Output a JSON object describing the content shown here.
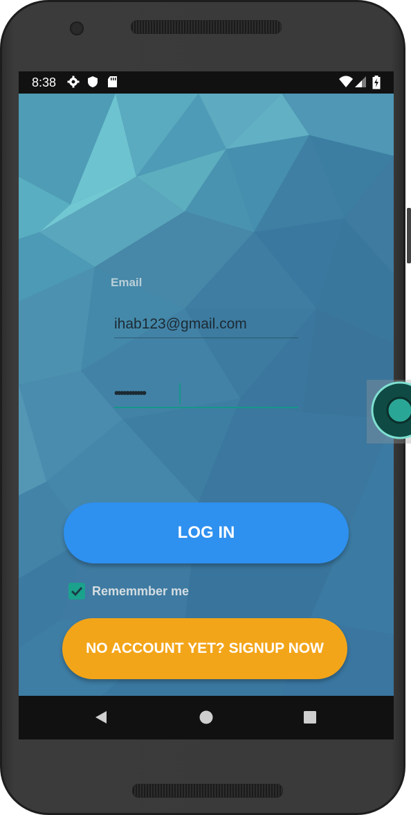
{
  "status_bar": {
    "time": "8:38",
    "icons_left": [
      "gear-icon",
      "shield-icon",
      "sd-card-icon"
    ],
    "icons_right": [
      "wifi-icon",
      "signal-icon",
      "battery-charging-icon"
    ]
  },
  "login_form": {
    "email_label": "Email",
    "email_value": "ihab123@gmail.com",
    "password_masked": "•••••••••••",
    "login_button": "LOG IN",
    "remember_label": "Rememmber me",
    "remember_checked": true,
    "signup_button": "NO ACCOUNT YET? SIGNUP NOW"
  },
  "nav_bar": {
    "buttons": [
      "back-icon",
      "home-icon",
      "recents-icon"
    ]
  },
  "colors": {
    "login_button": "#2e90ef",
    "signup_button": "#f3a519",
    "checkbox": "#1aa28c",
    "accent_underline": "#16968a"
  }
}
